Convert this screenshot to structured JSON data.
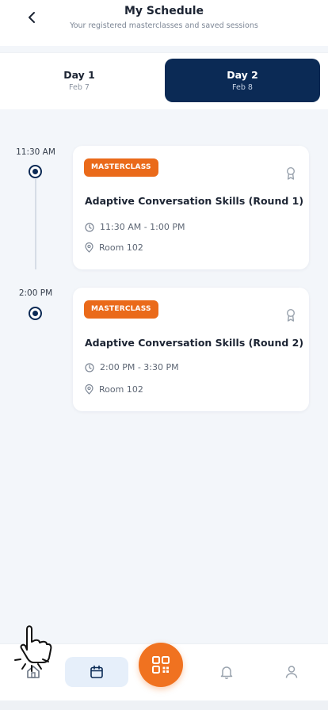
{
  "header": {
    "title": "My Schedule",
    "subtitle": "Your registered masterclasses and saved sessions",
    "back_icon": "chevron-left-icon"
  },
  "day_tabs": [
    {
      "label": "Day 1",
      "date": "Feb 7",
      "selected": false
    },
    {
      "label": "Day 2",
      "date": "Feb 8",
      "selected": true
    }
  ],
  "sessions": [
    {
      "time": "11:30 AM",
      "badge": "MASTERCLASS",
      "title": "Adaptive Conversation Skills (Round 1)",
      "time_range": "11:30 AM - 1:00 PM",
      "room": "Room 102"
    },
    {
      "time": "2:00 PM",
      "badge": "MASTERCLASS",
      "title": "Adaptive Conversation Skills (Round 2)",
      "time_range": "2:00 PM - 3:30 PM",
      "room": "Room 102"
    }
  ],
  "bottom_nav": {
    "items": [
      "home-icon",
      "calendar-icon",
      "qr-code-icon",
      "bell-icon",
      "user-icon"
    ],
    "active": "calendar-icon"
  },
  "colors": {
    "navy": "#0b2a55",
    "orange": "#ea6a1a",
    "background": "#f3f6fa"
  }
}
